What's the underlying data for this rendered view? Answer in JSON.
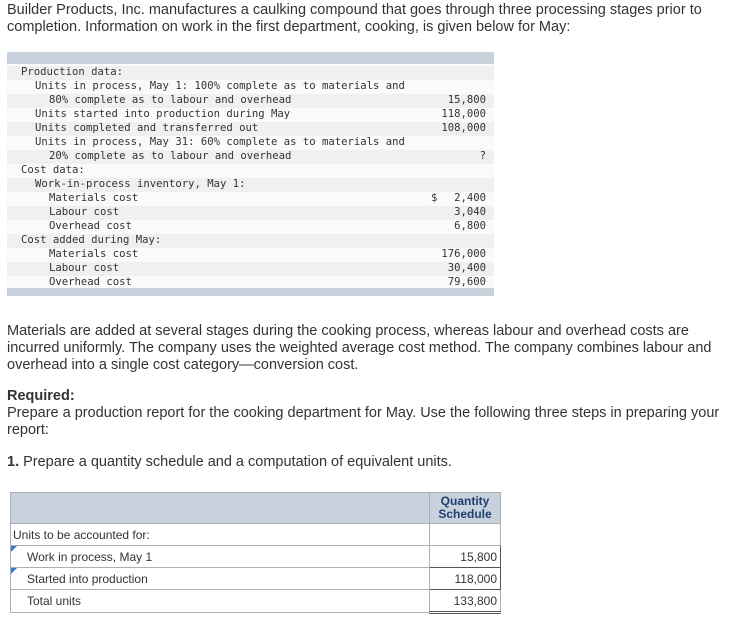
{
  "intro": "Builder Products, Inc. manufactures a caulking compound that goes through three processing stages prior to completion. Information on work in the first department, cooking, is given below for May:",
  "data_rows": [
    {
      "label": "Production data:",
      "indent": 0,
      "value": "",
      "dollar": ""
    },
    {
      "label": "Units in process, May 1: 100% complete as to materials and",
      "indent": 1,
      "value": "",
      "dollar": ""
    },
    {
      "label": "80% complete as to labour and overhead",
      "indent": 2,
      "value": "15,800",
      "dollar": ""
    },
    {
      "label": "Units started into production during May",
      "indent": 1,
      "value": "118,000",
      "dollar": ""
    },
    {
      "label": "Units completed and transferred out",
      "indent": 1,
      "value": "108,000",
      "dollar": ""
    },
    {
      "label": "Units in process, May 31: 60% complete as to materials and",
      "indent": 1,
      "value": "",
      "dollar": ""
    },
    {
      "label": "20% complete as to labour and overhead",
      "indent": 2,
      "value": "?",
      "dollar": ""
    },
    {
      "label": "Cost data:",
      "indent": 0,
      "value": "",
      "dollar": ""
    },
    {
      "label": "Work-in-process inventory, May 1:",
      "indent": 1,
      "value": "",
      "dollar": ""
    },
    {
      "label": "Materials cost",
      "indent": 2,
      "value": "2,400",
      "dollar": "$"
    },
    {
      "label": "Labour cost",
      "indent": 2,
      "value": "3,040",
      "dollar": ""
    },
    {
      "label": "Overhead cost",
      "indent": 2,
      "value": "6,800",
      "dollar": ""
    },
    {
      "label": "Cost added during May:",
      "indent": 0,
      "value": "",
      "dollar": ""
    },
    {
      "label": "Materials cost",
      "indent": 2,
      "value": "176,000",
      "dollar": ""
    },
    {
      "label": "Labour cost",
      "indent": 2,
      "value": "30,400",
      "dollar": ""
    },
    {
      "label": "Overhead cost",
      "indent": 2,
      "value": "79,600",
      "dollar": ""
    }
  ],
  "paragraph": "Materials are added at several stages during the cooking process, whereas labour and overhead costs are incurred uniformly. The company uses the weighted average cost method. The company combines labour and overhead into a single cost category—conversion cost.",
  "required_title": "Required:",
  "required_body": "Prepare a production report for the cooking department for May. Use the following three steps in preparing your report:",
  "step_number": "1.",
  "step_text": " Prepare a quantity schedule and a computation of equivalent units.",
  "schedule": {
    "header": "Quantity Schedule",
    "section_label": "Units to be accounted for:",
    "rows": [
      {
        "label": "Work in process, May 1",
        "value": "15,800"
      },
      {
        "label": "Started into production",
        "value": "118,000"
      },
      {
        "label": "Total units",
        "value": "133,800"
      }
    ]
  },
  "colors": {
    "header_bg": "#c9d1dc",
    "header_text": "#1f3f73",
    "marker": "#3a78c8"
  }
}
